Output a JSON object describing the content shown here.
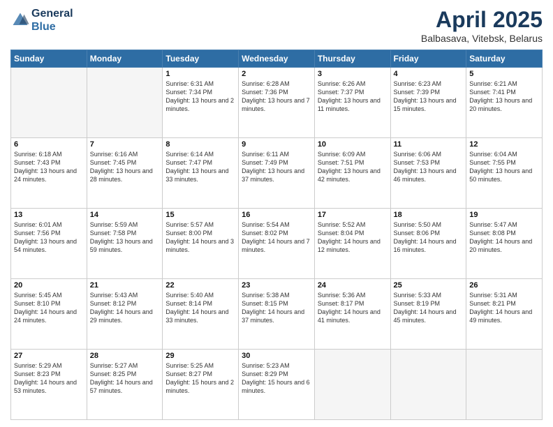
{
  "header": {
    "logo_line1": "General",
    "logo_line2": "Blue",
    "title": "April 2025",
    "subtitle": "Balbasava, Vitebsk, Belarus"
  },
  "days_of_week": [
    "Sunday",
    "Monday",
    "Tuesday",
    "Wednesday",
    "Thursday",
    "Friday",
    "Saturday"
  ],
  "weeks": [
    [
      {
        "day": "",
        "info": ""
      },
      {
        "day": "",
        "info": ""
      },
      {
        "day": "1",
        "info": "Sunrise: 6:31 AM\nSunset: 7:34 PM\nDaylight: 13 hours and 2 minutes."
      },
      {
        "day": "2",
        "info": "Sunrise: 6:28 AM\nSunset: 7:36 PM\nDaylight: 13 hours and 7 minutes."
      },
      {
        "day": "3",
        "info": "Sunrise: 6:26 AM\nSunset: 7:37 PM\nDaylight: 13 hours and 11 minutes."
      },
      {
        "day": "4",
        "info": "Sunrise: 6:23 AM\nSunset: 7:39 PM\nDaylight: 13 hours and 15 minutes."
      },
      {
        "day": "5",
        "info": "Sunrise: 6:21 AM\nSunset: 7:41 PM\nDaylight: 13 hours and 20 minutes."
      }
    ],
    [
      {
        "day": "6",
        "info": "Sunrise: 6:18 AM\nSunset: 7:43 PM\nDaylight: 13 hours and 24 minutes."
      },
      {
        "day": "7",
        "info": "Sunrise: 6:16 AM\nSunset: 7:45 PM\nDaylight: 13 hours and 28 minutes."
      },
      {
        "day": "8",
        "info": "Sunrise: 6:14 AM\nSunset: 7:47 PM\nDaylight: 13 hours and 33 minutes."
      },
      {
        "day": "9",
        "info": "Sunrise: 6:11 AM\nSunset: 7:49 PM\nDaylight: 13 hours and 37 minutes."
      },
      {
        "day": "10",
        "info": "Sunrise: 6:09 AM\nSunset: 7:51 PM\nDaylight: 13 hours and 42 minutes."
      },
      {
        "day": "11",
        "info": "Sunrise: 6:06 AM\nSunset: 7:53 PM\nDaylight: 13 hours and 46 minutes."
      },
      {
        "day": "12",
        "info": "Sunrise: 6:04 AM\nSunset: 7:55 PM\nDaylight: 13 hours and 50 minutes."
      }
    ],
    [
      {
        "day": "13",
        "info": "Sunrise: 6:01 AM\nSunset: 7:56 PM\nDaylight: 13 hours and 54 minutes."
      },
      {
        "day": "14",
        "info": "Sunrise: 5:59 AM\nSunset: 7:58 PM\nDaylight: 13 hours and 59 minutes."
      },
      {
        "day": "15",
        "info": "Sunrise: 5:57 AM\nSunset: 8:00 PM\nDaylight: 14 hours and 3 minutes."
      },
      {
        "day": "16",
        "info": "Sunrise: 5:54 AM\nSunset: 8:02 PM\nDaylight: 14 hours and 7 minutes."
      },
      {
        "day": "17",
        "info": "Sunrise: 5:52 AM\nSunset: 8:04 PM\nDaylight: 14 hours and 12 minutes."
      },
      {
        "day": "18",
        "info": "Sunrise: 5:50 AM\nSunset: 8:06 PM\nDaylight: 14 hours and 16 minutes."
      },
      {
        "day": "19",
        "info": "Sunrise: 5:47 AM\nSunset: 8:08 PM\nDaylight: 14 hours and 20 minutes."
      }
    ],
    [
      {
        "day": "20",
        "info": "Sunrise: 5:45 AM\nSunset: 8:10 PM\nDaylight: 14 hours and 24 minutes."
      },
      {
        "day": "21",
        "info": "Sunrise: 5:43 AM\nSunset: 8:12 PM\nDaylight: 14 hours and 29 minutes."
      },
      {
        "day": "22",
        "info": "Sunrise: 5:40 AM\nSunset: 8:14 PM\nDaylight: 14 hours and 33 minutes."
      },
      {
        "day": "23",
        "info": "Sunrise: 5:38 AM\nSunset: 8:15 PM\nDaylight: 14 hours and 37 minutes."
      },
      {
        "day": "24",
        "info": "Sunrise: 5:36 AM\nSunset: 8:17 PM\nDaylight: 14 hours and 41 minutes."
      },
      {
        "day": "25",
        "info": "Sunrise: 5:33 AM\nSunset: 8:19 PM\nDaylight: 14 hours and 45 minutes."
      },
      {
        "day": "26",
        "info": "Sunrise: 5:31 AM\nSunset: 8:21 PM\nDaylight: 14 hours and 49 minutes."
      }
    ],
    [
      {
        "day": "27",
        "info": "Sunrise: 5:29 AM\nSunset: 8:23 PM\nDaylight: 14 hours and 53 minutes."
      },
      {
        "day": "28",
        "info": "Sunrise: 5:27 AM\nSunset: 8:25 PM\nDaylight: 14 hours and 57 minutes."
      },
      {
        "day": "29",
        "info": "Sunrise: 5:25 AM\nSunset: 8:27 PM\nDaylight: 15 hours and 2 minutes."
      },
      {
        "day": "30",
        "info": "Sunrise: 5:23 AM\nSunset: 8:29 PM\nDaylight: 15 hours and 6 minutes."
      },
      {
        "day": "",
        "info": ""
      },
      {
        "day": "",
        "info": ""
      },
      {
        "day": "",
        "info": ""
      }
    ]
  ]
}
